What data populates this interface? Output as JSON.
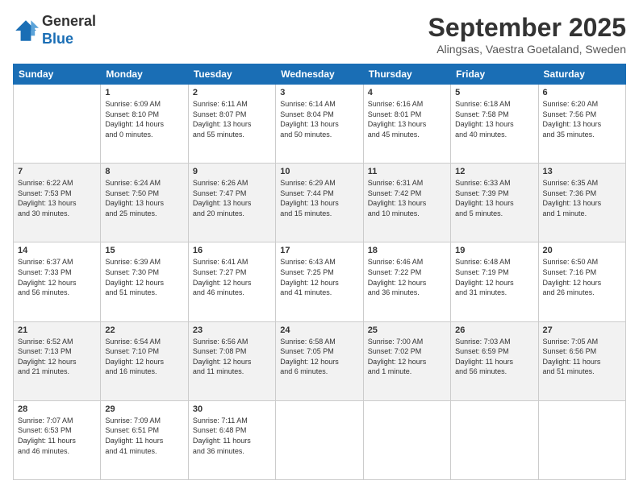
{
  "header": {
    "logo_line1": "General",
    "logo_line2": "Blue",
    "month_title": "September 2025",
    "location": "Alingsas, Vaestra Goetaland, Sweden"
  },
  "weekdays": [
    "Sunday",
    "Monday",
    "Tuesday",
    "Wednesday",
    "Thursday",
    "Friday",
    "Saturday"
  ],
  "weeks": [
    [
      {
        "day": "",
        "info": ""
      },
      {
        "day": "1",
        "info": "Sunrise: 6:09 AM\nSunset: 8:10 PM\nDaylight: 14 hours\nand 0 minutes."
      },
      {
        "day": "2",
        "info": "Sunrise: 6:11 AM\nSunset: 8:07 PM\nDaylight: 13 hours\nand 55 minutes."
      },
      {
        "day": "3",
        "info": "Sunrise: 6:14 AM\nSunset: 8:04 PM\nDaylight: 13 hours\nand 50 minutes."
      },
      {
        "day": "4",
        "info": "Sunrise: 6:16 AM\nSunset: 8:01 PM\nDaylight: 13 hours\nand 45 minutes."
      },
      {
        "day": "5",
        "info": "Sunrise: 6:18 AM\nSunset: 7:58 PM\nDaylight: 13 hours\nand 40 minutes."
      },
      {
        "day": "6",
        "info": "Sunrise: 6:20 AM\nSunset: 7:56 PM\nDaylight: 13 hours\nand 35 minutes."
      }
    ],
    [
      {
        "day": "7",
        "info": "Sunrise: 6:22 AM\nSunset: 7:53 PM\nDaylight: 13 hours\nand 30 minutes."
      },
      {
        "day": "8",
        "info": "Sunrise: 6:24 AM\nSunset: 7:50 PM\nDaylight: 13 hours\nand 25 minutes."
      },
      {
        "day": "9",
        "info": "Sunrise: 6:26 AM\nSunset: 7:47 PM\nDaylight: 13 hours\nand 20 minutes."
      },
      {
        "day": "10",
        "info": "Sunrise: 6:29 AM\nSunset: 7:44 PM\nDaylight: 13 hours\nand 15 minutes."
      },
      {
        "day": "11",
        "info": "Sunrise: 6:31 AM\nSunset: 7:42 PM\nDaylight: 13 hours\nand 10 minutes."
      },
      {
        "day": "12",
        "info": "Sunrise: 6:33 AM\nSunset: 7:39 PM\nDaylight: 13 hours\nand 5 minutes."
      },
      {
        "day": "13",
        "info": "Sunrise: 6:35 AM\nSunset: 7:36 PM\nDaylight: 13 hours\nand 1 minute."
      }
    ],
    [
      {
        "day": "14",
        "info": "Sunrise: 6:37 AM\nSunset: 7:33 PM\nDaylight: 12 hours\nand 56 minutes."
      },
      {
        "day": "15",
        "info": "Sunrise: 6:39 AM\nSunset: 7:30 PM\nDaylight: 12 hours\nand 51 minutes."
      },
      {
        "day": "16",
        "info": "Sunrise: 6:41 AM\nSunset: 7:27 PM\nDaylight: 12 hours\nand 46 minutes."
      },
      {
        "day": "17",
        "info": "Sunrise: 6:43 AM\nSunset: 7:25 PM\nDaylight: 12 hours\nand 41 minutes."
      },
      {
        "day": "18",
        "info": "Sunrise: 6:46 AM\nSunset: 7:22 PM\nDaylight: 12 hours\nand 36 minutes."
      },
      {
        "day": "19",
        "info": "Sunrise: 6:48 AM\nSunset: 7:19 PM\nDaylight: 12 hours\nand 31 minutes."
      },
      {
        "day": "20",
        "info": "Sunrise: 6:50 AM\nSunset: 7:16 PM\nDaylight: 12 hours\nand 26 minutes."
      }
    ],
    [
      {
        "day": "21",
        "info": "Sunrise: 6:52 AM\nSunset: 7:13 PM\nDaylight: 12 hours\nand 21 minutes."
      },
      {
        "day": "22",
        "info": "Sunrise: 6:54 AM\nSunset: 7:10 PM\nDaylight: 12 hours\nand 16 minutes."
      },
      {
        "day": "23",
        "info": "Sunrise: 6:56 AM\nSunset: 7:08 PM\nDaylight: 12 hours\nand 11 minutes."
      },
      {
        "day": "24",
        "info": "Sunrise: 6:58 AM\nSunset: 7:05 PM\nDaylight: 12 hours\nand 6 minutes."
      },
      {
        "day": "25",
        "info": "Sunrise: 7:00 AM\nSunset: 7:02 PM\nDaylight: 12 hours\nand 1 minute."
      },
      {
        "day": "26",
        "info": "Sunrise: 7:03 AM\nSunset: 6:59 PM\nDaylight: 11 hours\nand 56 minutes."
      },
      {
        "day": "27",
        "info": "Sunrise: 7:05 AM\nSunset: 6:56 PM\nDaylight: 11 hours\nand 51 minutes."
      }
    ],
    [
      {
        "day": "28",
        "info": "Sunrise: 7:07 AM\nSunset: 6:53 PM\nDaylight: 11 hours\nand 46 minutes."
      },
      {
        "day": "29",
        "info": "Sunrise: 7:09 AM\nSunset: 6:51 PM\nDaylight: 11 hours\nand 41 minutes."
      },
      {
        "day": "30",
        "info": "Sunrise: 7:11 AM\nSunset: 6:48 PM\nDaylight: 11 hours\nand 36 minutes."
      },
      {
        "day": "",
        "info": ""
      },
      {
        "day": "",
        "info": ""
      },
      {
        "day": "",
        "info": ""
      },
      {
        "day": "",
        "info": ""
      }
    ]
  ]
}
